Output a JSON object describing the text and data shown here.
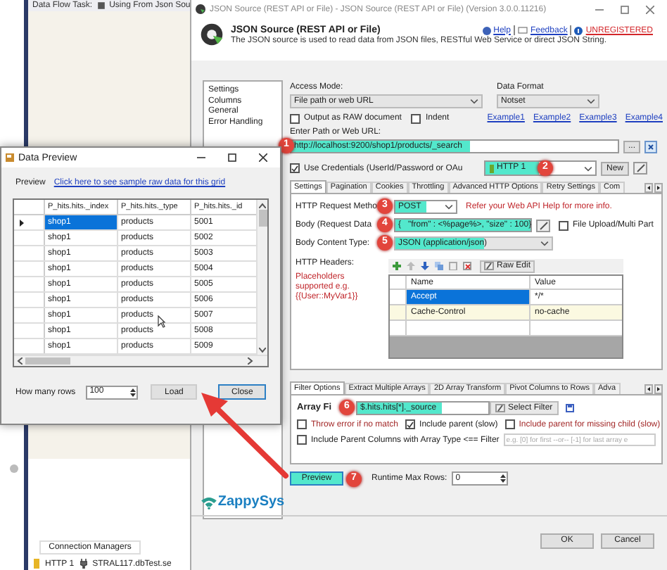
{
  "background": {
    "tab_title": "Data Flow Task:",
    "task": "Using From Json Sou",
    "connection_managers_tab": "Connection Managers",
    "connections": [
      {
        "label": "HTTP 1",
        "kind": "http"
      },
      {
        "label": "STRAL117.dbTest.se",
        "kind": "db"
      }
    ]
  },
  "main_window": {
    "title": "JSON Source (REST API or File) - JSON Source (REST API or File) (Version 3.0.0.11216)",
    "heading": "JSON Source (REST API or File)",
    "description": "The JSON source is used to read data from JSON files, RESTful Web Service or direct JSON String.",
    "links": [
      {
        "label": "Help",
        "kind": "help"
      },
      {
        "label": "Feedback",
        "kind": "feedback"
      },
      {
        "label": "UNREGISTERED",
        "kind": "warning"
      }
    ],
    "nav": [
      {
        "label": "Settings"
      },
      {
        "label": "Columns"
      },
      {
        "label": "General"
      },
      {
        "label": "Error Handling"
      }
    ],
    "brand": "ZappySys",
    "access_mode": {
      "label": "Access Mode:",
      "value": "File path or web URL"
    },
    "data_format": {
      "label": "Data Format",
      "value": "Notset"
    },
    "options": [
      {
        "label": "Output as RAW document",
        "checked": false
      },
      {
        "label": "Indent",
        "checked": false
      }
    ],
    "examples": [
      "Example1",
      "Example2",
      "Example3",
      "Example4"
    ],
    "url": {
      "label": "Enter Path or Web URL:",
      "value": "http://localhost:9200/shop1/products/_search",
      "badge": "1",
      "browse_button": "..."
    },
    "credentials": {
      "label": "Use Credentials (UserId/Password or OAu",
      "checked": true,
      "connection": "HTTP 1",
      "badge": "2",
      "new_button": "New"
    },
    "tabs": [
      {
        "label": "Settings",
        "selected": true
      },
      {
        "label": "Pagination",
        "selected": false
      },
      {
        "label": "Cookies",
        "selected": false
      },
      {
        "label": "Throttling",
        "selected": false
      },
      {
        "label": "Advanced HTTP Options",
        "selected": false
      },
      {
        "label": "Retry Settings",
        "selected": false
      },
      {
        "label": "Com",
        "selected": false
      }
    ],
    "method": {
      "label": "HTTP Request Metho",
      "value": "POST",
      "badge": "3",
      "hint": "Refer your Web API Help for more info."
    },
    "body": {
      "label": "Body (Request Data",
      "value": "{   \"from\" : <%page%>, \"size\" : 100}",
      "badge": "4",
      "file_upload": {
        "label": "File Upload/Multi Part",
        "checked": false
      }
    },
    "content_type": {
      "label": "Body Content Type:",
      "value": "JSON (application/json)",
      "badge": "5"
    },
    "headers": {
      "label": "HTTP Headers:",
      "note": "Placeholders supported e.g. {{User::MyVar1}}",
      "raw_edit": "Raw Edit",
      "columns": [
        "Name",
        "Value"
      ],
      "rows": [
        {
          "name": "Accept",
          "value": "*/*",
          "selected": true
        },
        {
          "name": "Cache-Control",
          "value": "no-cache",
          "selected": false
        }
      ]
    },
    "filter_tabs": [
      {
        "label": "Filter Options",
        "selected": true
      },
      {
        "label": "Extract Multiple Arrays",
        "selected": false
      },
      {
        "label": "2D Array Transform",
        "selected": false
      },
      {
        "label": "Pivot Columns to Rows",
        "selected": false
      },
      {
        "label": "Adva",
        "selected": false
      }
    ],
    "array_filter": {
      "label": "Array Fi",
      "value": "$.hits.hits[*]._source",
      "badge": "6",
      "select_button": "Select Filter"
    },
    "filter_options": [
      {
        "label": "Throw error if no match",
        "checked": false
      },
      {
        "label": "Include parent (slow)",
        "checked": true
      },
      {
        "label": "Include parent for missing child (slow)",
        "checked": false
      }
    ],
    "parent_columns": {
      "label": "Include Parent Columns with Array Type <== Filter",
      "checked": false,
      "placeholder": "e.g. [0] for first --or-- [-1] for last array e"
    },
    "preview_button": "Preview",
    "preview_badge": "7",
    "runtime_max_rows": {
      "label": "Runtime Max Rows:",
      "value": "0"
    },
    "buttons": [
      "OK",
      "Cancel"
    ]
  },
  "data_preview": {
    "title": "Data Preview",
    "preview_label": "Preview",
    "raw_link": "Click here to see sample raw data for this grid",
    "columns": [
      "P_hits.hits._index",
      "P_hits.hits._type",
      "P_hits.hits._id"
    ],
    "rows": [
      {
        "cells": [
          "shop1",
          "products",
          "5001"
        ],
        "selected": true
      },
      {
        "cells": [
          "shop1",
          "products",
          "5002"
        ],
        "selected": false
      },
      {
        "cells": [
          "shop1",
          "products",
          "5003"
        ],
        "selected": false
      },
      {
        "cells": [
          "shop1",
          "products",
          "5004"
        ],
        "selected": false
      },
      {
        "cells": [
          "shop1",
          "products",
          "5005"
        ],
        "selected": false
      },
      {
        "cells": [
          "shop1",
          "products",
          "5006"
        ],
        "selected": false
      },
      {
        "cells": [
          "shop1",
          "products",
          "5007"
        ],
        "selected": false
      },
      {
        "cells": [
          "shop1",
          "products",
          "5008"
        ],
        "selected": false
      },
      {
        "cells": [
          "shop1",
          "products",
          "5009"
        ],
        "selected": false
      }
    ],
    "rows_label": "How many rows",
    "rows_value": "100",
    "load_button": "Load",
    "close_button": "Close"
  }
}
